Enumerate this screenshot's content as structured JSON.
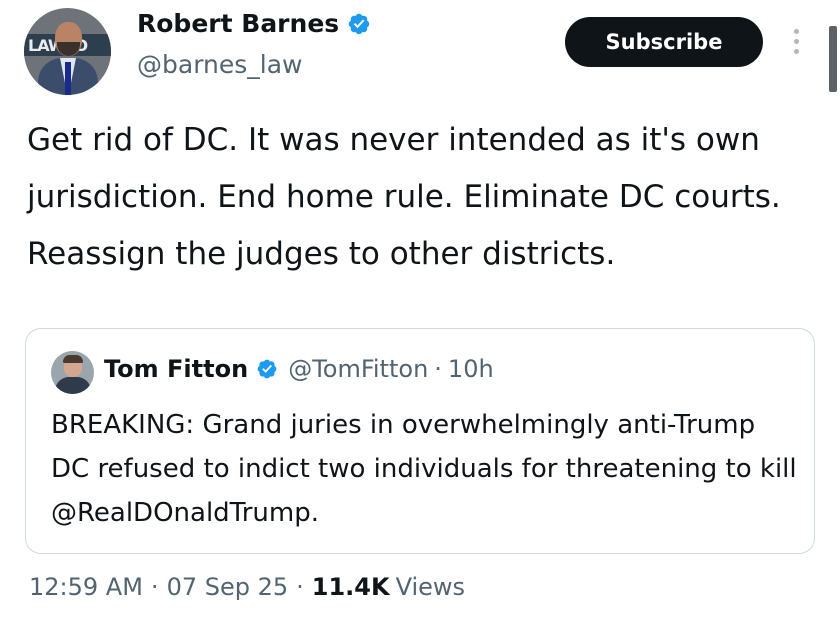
{
  "author": {
    "name": "Robert Barnes",
    "handle": "@barnes_law",
    "avatar_sign_text": "LAWYO"
  },
  "header": {
    "subscribe_label": "Subscribe",
    "more_icon": "more-vertical-icon"
  },
  "tweet": {
    "text": "Get rid of DC. It was never intended as it's own jurisdiction. End home rule. Eliminate DC courts. Reassign the judges to other districts."
  },
  "quote": {
    "name": "Tom Fitton",
    "handle": "@TomFitton",
    "separator": "·",
    "time": "10h",
    "text": "BREAKING: Grand juries in overwhelmingly anti-Trump DC refused to indict two individuals for threatening to kill @RealDOnaldTrump."
  },
  "meta": {
    "time": "12:59 AM",
    "date": "07 Sep 25",
    "separator": "·",
    "views_count": "11.4K",
    "views_label": "Views"
  },
  "colors": {
    "verified_blue": "#1d9bf0",
    "text_primary": "#0f1419",
    "text_secondary": "#536471",
    "border": "#cfd9de"
  }
}
